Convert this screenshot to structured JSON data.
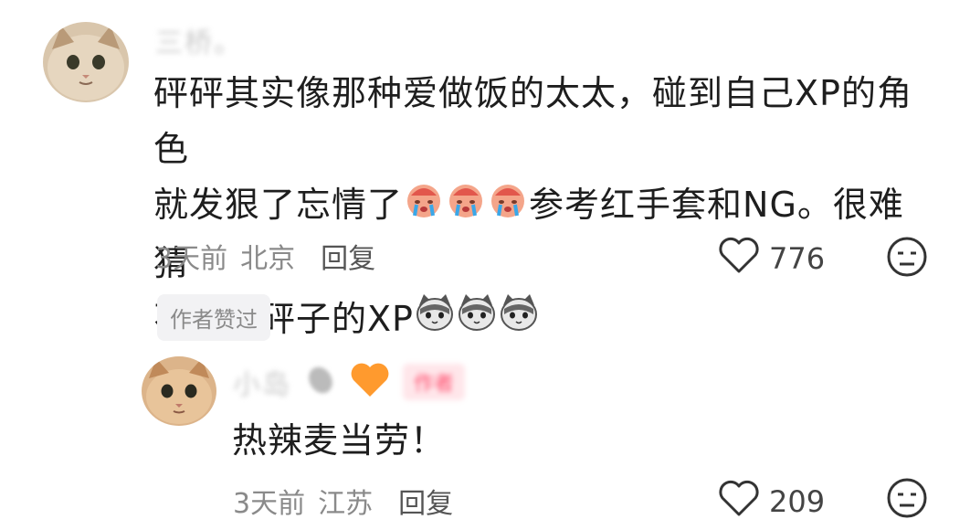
{
  "comments": [
    {
      "username": "三桥。",
      "text_lines": [
        "砰砰其实像那种爱做饭的太太，碰到自己XP的角色",
        "就发狠了忘情了",
        "参考红手套和NG。很难猜",
        "不出来砰子的XP"
      ],
      "time": "3天前",
      "location": "北京",
      "reply_label": "回复",
      "likes": "776",
      "badge": "作者赞过"
    },
    {
      "username": "小岛",
      "tag": "作者",
      "text": "热辣麦当劳！",
      "time": "3天前",
      "location": "江苏",
      "reply_label": "回复",
      "likes": "209"
    }
  ]
}
